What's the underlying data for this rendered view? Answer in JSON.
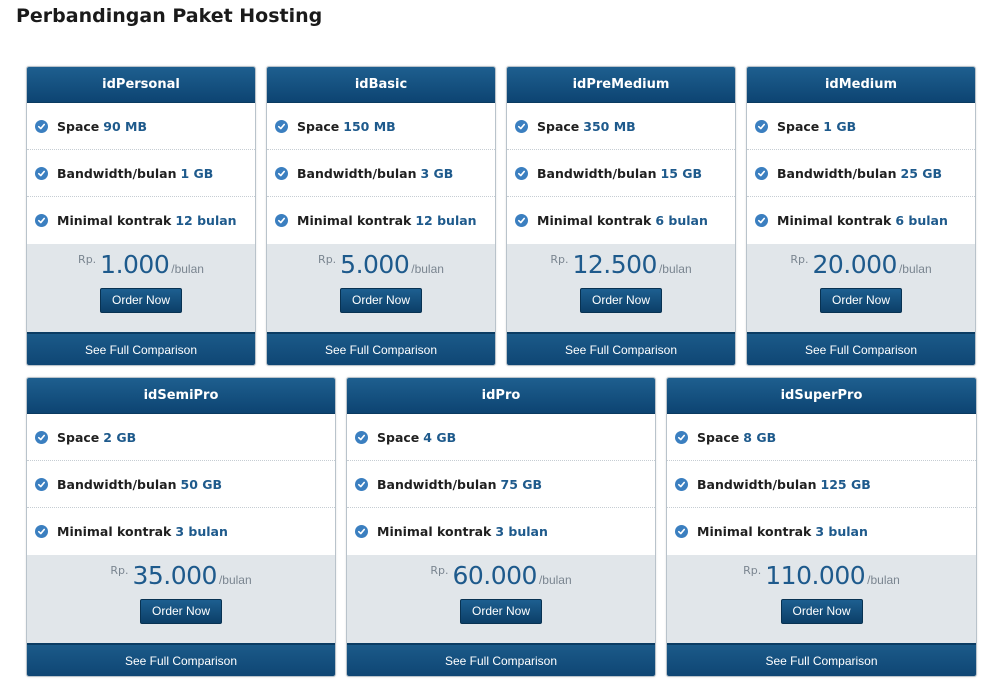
{
  "page": {
    "title": "Perbandingan Paket Hosting"
  },
  "labels": {
    "space": "Space",
    "bandwidth": "Bandwidth/bulan",
    "contract": "Minimal kontrak",
    "currency": "Rp.",
    "per": "/bulan",
    "order": "Order Now",
    "compare": "See Full Comparison"
  },
  "colors": {
    "header": "#0d4472",
    "accent": "#1e5a8c",
    "price_bg": "#e1e6ea",
    "check": "#3b7fc0"
  },
  "plans": [
    {
      "name": "idPersonal",
      "space": "90 MB",
      "bandwidth": "1 GB",
      "contract": "12 bulan",
      "price": "1.000"
    },
    {
      "name": "idBasic",
      "space": "150 MB",
      "bandwidth": "3 GB",
      "contract": "12 bulan",
      "price": "5.000"
    },
    {
      "name": "idPreMedium",
      "space": "350 MB",
      "bandwidth": "15 GB",
      "contract": "6 bulan",
      "price": "12.500"
    },
    {
      "name": "idMedium",
      "space": "1 GB",
      "bandwidth": "25 GB",
      "contract": "6 bulan",
      "price": "20.000"
    },
    {
      "name": "idSemiPro",
      "space": "2 GB",
      "bandwidth": "50 GB",
      "contract": "3 bulan",
      "price": "35.000"
    },
    {
      "name": "idPro",
      "space": "4 GB",
      "bandwidth": "75 GB",
      "contract": "3 bulan",
      "price": "60.000"
    },
    {
      "name": "idSuperPro",
      "space": "8 GB",
      "bandwidth": "125 GB",
      "contract": "3 bulan",
      "price": "110.000"
    }
  ]
}
